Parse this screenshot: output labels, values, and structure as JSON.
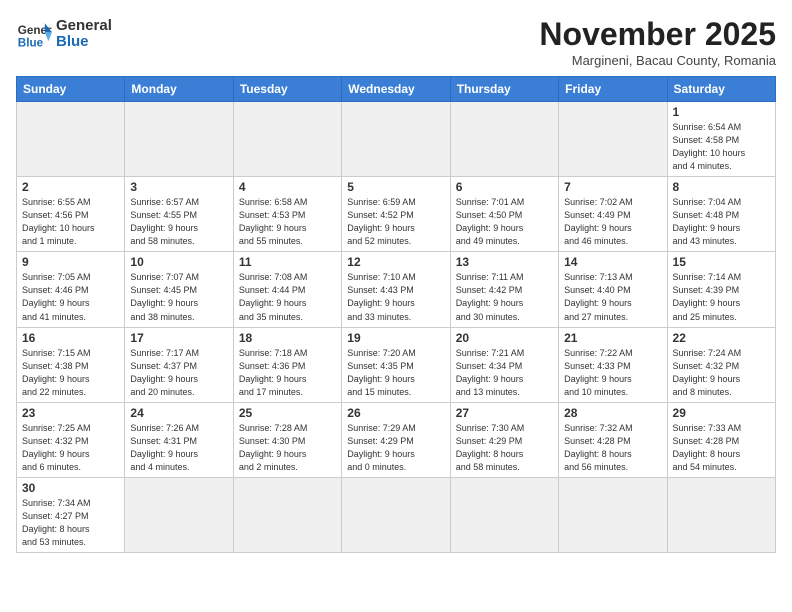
{
  "header": {
    "logo_general": "General",
    "logo_blue": "Blue",
    "month": "November 2025",
    "location": "Margineni, Bacau County, Romania"
  },
  "weekdays": [
    "Sunday",
    "Monday",
    "Tuesday",
    "Wednesday",
    "Thursday",
    "Friday",
    "Saturday"
  ],
  "weeks": [
    [
      {
        "day": "",
        "info": ""
      },
      {
        "day": "",
        "info": ""
      },
      {
        "day": "",
        "info": ""
      },
      {
        "day": "",
        "info": ""
      },
      {
        "day": "",
        "info": ""
      },
      {
        "day": "",
        "info": ""
      },
      {
        "day": "1",
        "info": "Sunrise: 6:54 AM\nSunset: 4:58 PM\nDaylight: 10 hours\nand 4 minutes."
      }
    ],
    [
      {
        "day": "2",
        "info": "Sunrise: 6:55 AM\nSunset: 4:56 PM\nDaylight: 10 hours\nand 1 minute."
      },
      {
        "day": "3",
        "info": "Sunrise: 6:57 AM\nSunset: 4:55 PM\nDaylight: 9 hours\nand 58 minutes."
      },
      {
        "day": "4",
        "info": "Sunrise: 6:58 AM\nSunset: 4:53 PM\nDaylight: 9 hours\nand 55 minutes."
      },
      {
        "day": "5",
        "info": "Sunrise: 6:59 AM\nSunset: 4:52 PM\nDaylight: 9 hours\nand 52 minutes."
      },
      {
        "day": "6",
        "info": "Sunrise: 7:01 AM\nSunset: 4:50 PM\nDaylight: 9 hours\nand 49 minutes."
      },
      {
        "day": "7",
        "info": "Sunrise: 7:02 AM\nSunset: 4:49 PM\nDaylight: 9 hours\nand 46 minutes."
      },
      {
        "day": "8",
        "info": "Sunrise: 7:04 AM\nSunset: 4:48 PM\nDaylight: 9 hours\nand 43 minutes."
      }
    ],
    [
      {
        "day": "9",
        "info": "Sunrise: 7:05 AM\nSunset: 4:46 PM\nDaylight: 9 hours\nand 41 minutes."
      },
      {
        "day": "10",
        "info": "Sunrise: 7:07 AM\nSunset: 4:45 PM\nDaylight: 9 hours\nand 38 minutes."
      },
      {
        "day": "11",
        "info": "Sunrise: 7:08 AM\nSunset: 4:44 PM\nDaylight: 9 hours\nand 35 minutes."
      },
      {
        "day": "12",
        "info": "Sunrise: 7:10 AM\nSunset: 4:43 PM\nDaylight: 9 hours\nand 33 minutes."
      },
      {
        "day": "13",
        "info": "Sunrise: 7:11 AM\nSunset: 4:42 PM\nDaylight: 9 hours\nand 30 minutes."
      },
      {
        "day": "14",
        "info": "Sunrise: 7:13 AM\nSunset: 4:40 PM\nDaylight: 9 hours\nand 27 minutes."
      },
      {
        "day": "15",
        "info": "Sunrise: 7:14 AM\nSunset: 4:39 PM\nDaylight: 9 hours\nand 25 minutes."
      }
    ],
    [
      {
        "day": "16",
        "info": "Sunrise: 7:15 AM\nSunset: 4:38 PM\nDaylight: 9 hours\nand 22 minutes."
      },
      {
        "day": "17",
        "info": "Sunrise: 7:17 AM\nSunset: 4:37 PM\nDaylight: 9 hours\nand 20 minutes."
      },
      {
        "day": "18",
        "info": "Sunrise: 7:18 AM\nSunset: 4:36 PM\nDaylight: 9 hours\nand 17 minutes."
      },
      {
        "day": "19",
        "info": "Sunrise: 7:20 AM\nSunset: 4:35 PM\nDaylight: 9 hours\nand 15 minutes."
      },
      {
        "day": "20",
        "info": "Sunrise: 7:21 AM\nSunset: 4:34 PM\nDaylight: 9 hours\nand 13 minutes."
      },
      {
        "day": "21",
        "info": "Sunrise: 7:22 AM\nSunset: 4:33 PM\nDaylight: 9 hours\nand 10 minutes."
      },
      {
        "day": "22",
        "info": "Sunrise: 7:24 AM\nSunset: 4:32 PM\nDaylight: 9 hours\nand 8 minutes."
      }
    ],
    [
      {
        "day": "23",
        "info": "Sunrise: 7:25 AM\nSunset: 4:32 PM\nDaylight: 9 hours\nand 6 minutes."
      },
      {
        "day": "24",
        "info": "Sunrise: 7:26 AM\nSunset: 4:31 PM\nDaylight: 9 hours\nand 4 minutes."
      },
      {
        "day": "25",
        "info": "Sunrise: 7:28 AM\nSunset: 4:30 PM\nDaylight: 9 hours\nand 2 minutes."
      },
      {
        "day": "26",
        "info": "Sunrise: 7:29 AM\nSunset: 4:29 PM\nDaylight: 9 hours\nand 0 minutes."
      },
      {
        "day": "27",
        "info": "Sunrise: 7:30 AM\nSunset: 4:29 PM\nDaylight: 8 hours\nand 58 minutes."
      },
      {
        "day": "28",
        "info": "Sunrise: 7:32 AM\nSunset: 4:28 PM\nDaylight: 8 hours\nand 56 minutes."
      },
      {
        "day": "29",
        "info": "Sunrise: 7:33 AM\nSunset: 4:28 PM\nDaylight: 8 hours\nand 54 minutes."
      }
    ],
    [
      {
        "day": "30",
        "info": "Sunrise: 7:34 AM\nSunset: 4:27 PM\nDaylight: 8 hours\nand 53 minutes."
      },
      {
        "day": "",
        "info": ""
      },
      {
        "day": "",
        "info": ""
      },
      {
        "day": "",
        "info": ""
      },
      {
        "day": "",
        "info": ""
      },
      {
        "day": "",
        "info": ""
      },
      {
        "day": "",
        "info": ""
      }
    ]
  ]
}
